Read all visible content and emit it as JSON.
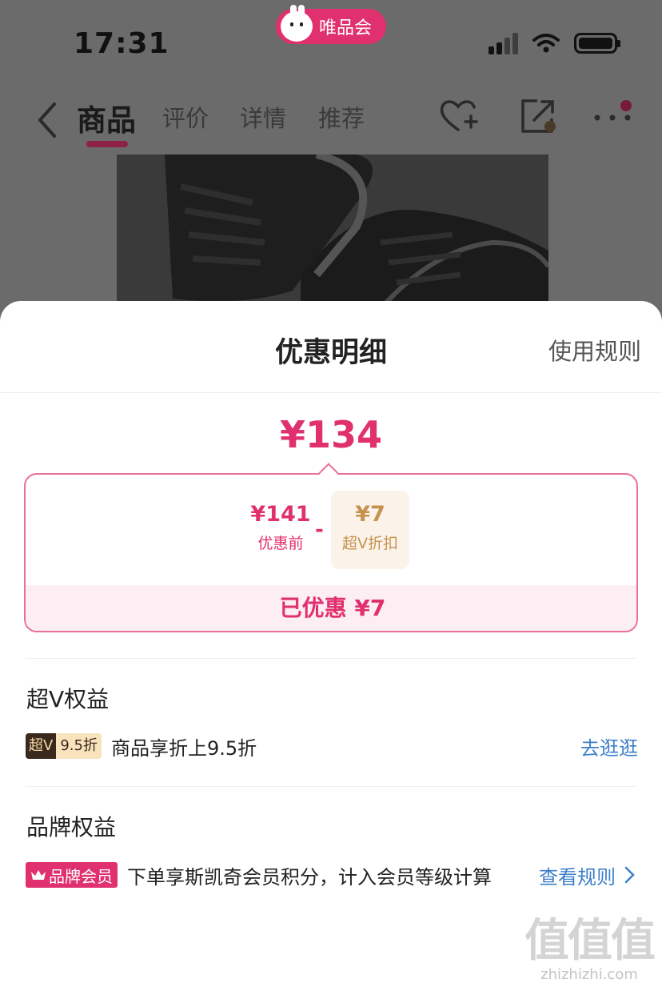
{
  "status_bar": {
    "time": "17:31",
    "app_name": "唯品会"
  },
  "nav": {
    "tabs": [
      {
        "label": "商品"
      },
      {
        "label": "评价"
      },
      {
        "label": "详情"
      },
      {
        "label": "推荐"
      }
    ]
  },
  "sheet": {
    "title": "优惠明细",
    "rules_link": "使用规则",
    "final_price": "¥134",
    "breakdown": {
      "before_amount": "¥141",
      "before_label": "优惠前",
      "minus_sign": "-",
      "discount_amount": "¥7",
      "discount_label": "超V折扣",
      "saved_text": "已优惠 ¥7"
    },
    "superv": {
      "section_title": "超V权益",
      "badge_left": "超V",
      "badge_right": "9.5折",
      "text": "商品享折上9.5折",
      "action": "去逛逛"
    },
    "brand": {
      "section_title": "品牌权益",
      "badge": "品牌会员",
      "text": "下单享斯凯奇会员积分，计入会员等级计算",
      "action": "查看规则"
    }
  },
  "watermark": {
    "logo": "值值值",
    "url": "zhizhizhi.com"
  },
  "colors": {
    "accent": "#e0306e",
    "link": "#3c7fc9",
    "gold": "#c6924e"
  }
}
